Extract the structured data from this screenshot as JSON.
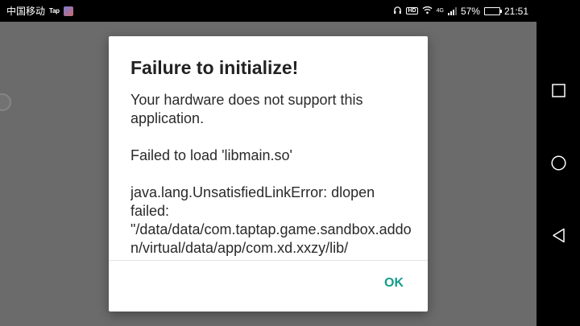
{
  "status_bar": {
    "carrier": "中国移动",
    "app_badge": "Tap",
    "network_type": "4G",
    "hd_label": "HD",
    "battery_percent": "57%",
    "battery_level": 0.57,
    "time": "21:51"
  },
  "dialog": {
    "title": "Failure to initialize!",
    "message": "Your hardware does not support this application.",
    "load_error": "Failed to load 'libmain.so'",
    "exception": "java.lang.UnsatisfiedLinkError: dlopen failed: \"/data/data/com.taptap.game.sandbox.addon/virtual/data/app/com.xd.xxzy/lib/",
    "ok_label": "OK"
  },
  "colors": {
    "accent": "#159c8c",
    "backdrop": "#6b6b6b",
    "battery_fill": "#3ec43e"
  },
  "icons": {
    "nav_recent": "square-icon",
    "nav_home": "circle-icon",
    "nav_back": "triangle-back-icon"
  }
}
